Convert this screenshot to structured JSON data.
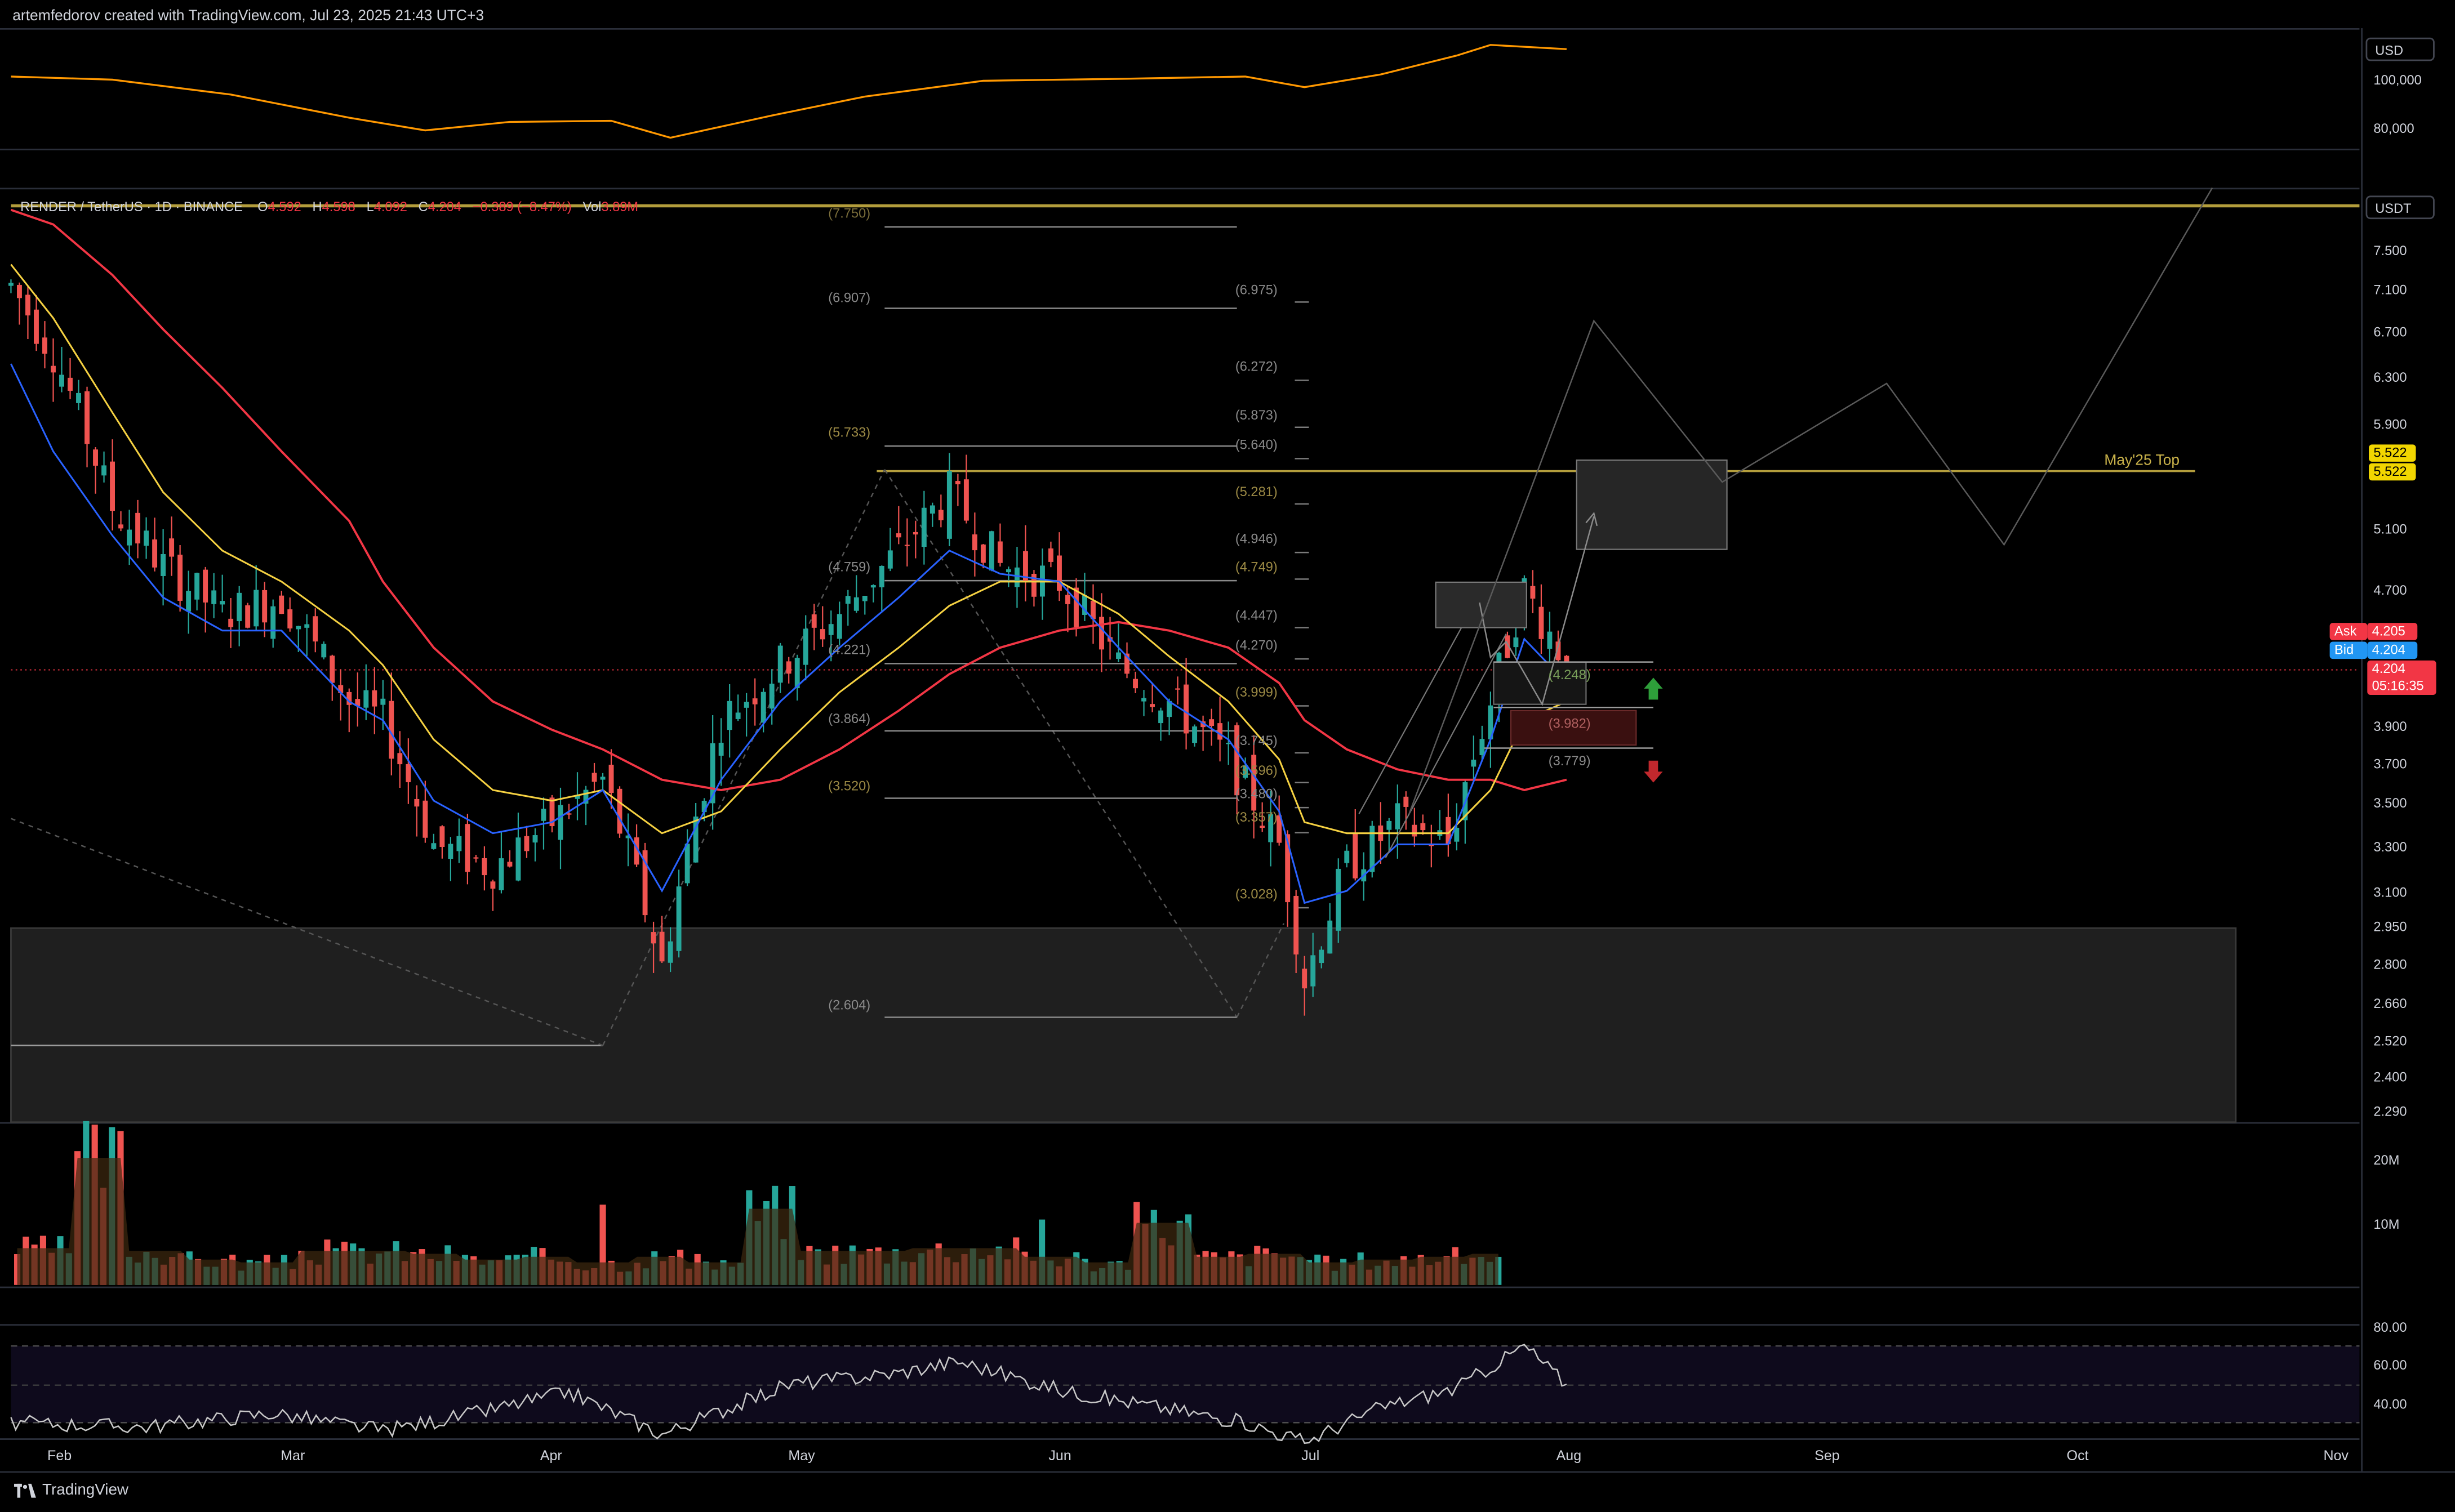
{
  "header": {
    "attribution": "artemfedorov created with TradingView.com, Jul 23, 2025 21:43 UTC+3"
  },
  "symbol_bar": {
    "symbol": "RENDER / TetherUS · 1D · BINANCE",
    "open_label": "O",
    "open": "4.592",
    "high_label": "H",
    "high": "4.598",
    "low_label": "L",
    "low": "4.092",
    "close_label": "C",
    "close": "4.204",
    "change": "−0.389 (−8.47%)",
    "vol_label": "Vol",
    "vol": "3.89M"
  },
  "top_pane": {
    "unit": "USD",
    "axis_labels": [
      "100,000",
      "80,000"
    ]
  },
  "main_pane": {
    "unit": "USDT",
    "axis_labels": [
      "7.500",
      "7.100",
      "6.700",
      "6.300",
      "5.900",
      "5.522",
      "5.100",
      "4.700",
      "4.300",
      "3.900",
      "3.700",
      "3.500",
      "3.300",
      "3.100",
      "2.950",
      "2.800",
      "2.660",
      "2.520",
      "2.400",
      "2.290"
    ],
    "price_tags": {
      "level_top": "5.522",
      "level_bottom": "5.522",
      "ask_label": "Ask",
      "ask": "4.205",
      "bid_label": "Bid",
      "bid": "4.204",
      "last": "4.204",
      "countdown": "05:16:35"
    },
    "annotation": "May'25 Top",
    "fib_left": [
      "(7.750)",
      "(6.907)",
      "(5.733)",
      "(4.759)",
      "(4.221)",
      "(3.864)",
      "(3.520)",
      "(2.604)"
    ],
    "fib_right": [
      "(6.975)",
      "(6.272)",
      "(5.873)",
      "(5.640)",
      "(5.281)",
      "(4.946)",
      "(4.749)",
      "(4.447)",
      "(4.270)",
      "(3.999)",
      "(3.745)",
      "(3.596)",
      "(3.480)",
      "(3.357)",
      "(3.028)"
    ],
    "target_labels": [
      "(4.248)",
      "(3.982)",
      "(3.779)"
    ]
  },
  "volume_pane": {
    "axis_labels": [
      "20M",
      "10M"
    ]
  },
  "rsi_pane": {
    "axis_labels": [
      "80.00",
      "60.00",
      "40.00"
    ]
  },
  "x_axis": {
    "months": [
      "Feb",
      "Mar",
      "Apr",
      "May",
      "Jun",
      "Jul",
      "Aug",
      "Sep",
      "Oct",
      "Nov"
    ]
  },
  "footer": {
    "brand": "TradingView"
  },
  "colors": {
    "background": "#000000",
    "up": "#26a69a",
    "down": "#ef5350",
    "ema_fast": "#2962ff",
    "ema_mid": "#f5d142",
    "ema_slow": "#f23645",
    "btc_line": "#ff9800",
    "level_line": "#c9b24a",
    "ask": "#f23645",
    "bid": "#2196f3",
    "fib": "#8a8a8a"
  },
  "chart_data": [
    {
      "type": "line",
      "pane": "BTC overlay (USD)",
      "x": [
        "2025-01-20",
        "2025-02-01",
        "2025-02-15",
        "2025-03-01",
        "2025-03-10",
        "2025-03-20",
        "2025-04-01",
        "2025-04-08",
        "2025-04-20",
        "2025-05-01",
        "2025-05-15",
        "2025-06-01",
        "2025-06-15",
        "2025-06-22",
        "2025-07-01",
        "2025-07-10",
        "2025-07-14",
        "2025-07-23"
      ],
      "values": [
        106000,
        104500,
        97500,
        86500,
        80500,
        84500,
        85000,
        77000,
        87500,
        96500,
        104000,
        105000,
        106000,
        101000,
        107000,
        116000,
        121000,
        119000
      ],
      "ylim": [
        74000,
        126000
      ]
    },
    {
      "type": "candlestick",
      "pane": "RENDER/USDT 1D",
      "x": [
        "2025-01-20",
        "2025-01-25",
        "2025-02-01",
        "2025-02-07",
        "2025-02-14",
        "2025-02-21",
        "2025-03-01",
        "2025-03-05",
        "2025-03-11",
        "2025-03-18",
        "2025-03-25",
        "2025-03-31",
        "2025-04-07",
        "2025-04-14",
        "2025-04-21",
        "2025-04-28",
        "2025-05-05",
        "2025-05-11",
        "2025-05-17",
        "2025-05-24",
        "2025-05-31",
        "2025-06-06",
        "2025-06-13",
        "2025-06-19",
        "2025-06-22",
        "2025-06-27",
        "2025-07-03",
        "2025-07-09",
        "2025-07-14",
        "2025-07-18",
        "2025-07-23"
      ],
      "close": [
        7.0,
        6.4,
        5.2,
        4.8,
        4.5,
        4.6,
        4.0,
        3.9,
        3.3,
        3.2,
        3.4,
        3.6,
        2.8,
        3.9,
        4.2,
        4.5,
        4.9,
        5.3,
        4.8,
        4.7,
        4.2,
        4.0,
        3.7,
        3.3,
        2.75,
        3.2,
        3.4,
        3.3,
        4.0,
        4.65,
        4.204
      ],
      "ylim": [
        2.29,
        7.85
      ]
    },
    {
      "type": "line",
      "pane": "EMAs",
      "series": [
        {
          "values": [
            6.3,
            5.6,
            5.0,
            4.6,
            4.4,
            4.4,
            4.0,
            3.9,
            3.5,
            3.35,
            3.4,
            3.55,
            3.1,
            3.6,
            4.0,
            4.3,
            4.6,
            4.9,
            4.75,
            4.7,
            4.3,
            4.0,
            3.8,
            3.45,
            3.05,
            3.1,
            3.3,
            3.3,
            3.8,
            4.35,
            4.1
          ]
        },
        {
          "values": [
            7.2,
            6.7,
            5.9,
            5.3,
            4.9,
            4.7,
            4.4,
            4.2,
            3.8,
            3.55,
            3.5,
            3.55,
            3.35,
            3.45,
            3.75,
            4.05,
            4.3,
            4.55,
            4.7,
            4.7,
            4.5,
            4.25,
            4.0,
            3.7,
            3.4,
            3.35,
            3.35,
            3.35,
            3.55,
            3.9,
            4.0
          ]
        },
        {
          "values": [
            7.75,
            7.6,
            7.1,
            6.6,
            6.1,
            5.6,
            5.1,
            4.7,
            4.3,
            4.0,
            3.85,
            3.75,
            3.6,
            3.55,
            3.6,
            3.75,
            3.95,
            4.15,
            4.3,
            4.4,
            4.45,
            4.4,
            4.3,
            4.1,
            3.9,
            3.75,
            3.65,
            3.6,
            3.6,
            3.55,
            3.6
          ]
        }
      ]
    },
    {
      "type": "bar",
      "pane": "Volume",
      "x": [
        "Jan-20",
        "Jan-27",
        "Feb-03",
        "Feb-10",
        "Feb-17",
        "Feb-24",
        "Mar-03",
        "Mar-10",
        "Mar-17",
        "Mar-24",
        "Mar-31",
        "Apr-07",
        "Apr-14",
        "Apr-21",
        "Apr-28",
        "May-05",
        "May-12",
        "May-19",
        "May-26",
        "Jun-02",
        "Jun-09",
        "Jun-16",
        "Jun-23",
        "Jun-30",
        "Jul-07",
        "Jul-14",
        "Jul-21"
      ],
      "values": [
        6.5,
        22.5,
        6,
        4.5,
        4,
        6,
        6,
        5.5,
        4.5,
        5,
        4,
        5,
        4,
        13.5,
        6,
        6,
        6.5,
        6.5,
        5,
        4,
        11,
        5,
        5.5,
        4,
        4.5,
        5,
        5.5
      ],
      "ylim": [
        0,
        25
      ]
    },
    {
      "type": "line",
      "pane": "RSI",
      "x": [
        "2025-01-20",
        "2025-02-05",
        "2025-02-20",
        "2025-03-05",
        "2025-03-15",
        "2025-03-27",
        "2025-04-07",
        "2025-04-22",
        "2025-05-05",
        "2025-05-12",
        "2025-05-25",
        "2025-06-05",
        "2025-06-15",
        "2025-06-22",
        "2025-07-01",
        "2025-07-10",
        "2025-07-18",
        "2025-07-23"
      ],
      "values": [
        40,
        38,
        45,
        36,
        44,
        56,
        34,
        60,
        66,
        72,
        56,
        48,
        40,
        30,
        48,
        58,
        80,
        60
      ],
      "ylim": [
        25,
        82
      ]
    }
  ]
}
